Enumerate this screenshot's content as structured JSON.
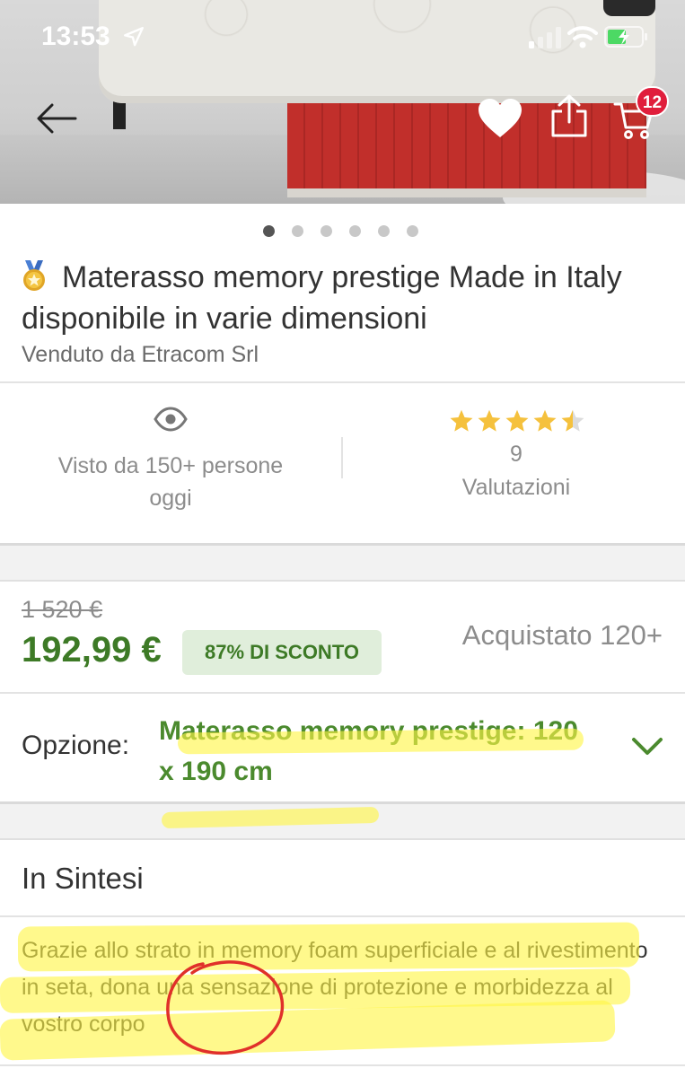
{
  "status_bar": {
    "time": "13:53"
  },
  "header": {
    "icons": [
      "back-arrow-icon",
      "heart-icon",
      "share-icon",
      "cart-icon"
    ],
    "cart_count": "12"
  },
  "carousel": {
    "total": 6,
    "active_index": 0
  },
  "product": {
    "title": "Materasso memory prestige Made in Italy disponibile in varie dimensioni",
    "seller": "Venduto da Etracom Srl"
  },
  "stats": {
    "views": "Visto da 150+ persone oggi",
    "rating": 4.5,
    "rating_count": "9",
    "rating_label": "Valutazioni"
  },
  "pricing": {
    "old_price": "1 520 €",
    "price": "192,99 €",
    "discount": "87% DI SCONTO",
    "bought": "Acquistato 120+"
  },
  "option": {
    "label": "Opzione:",
    "value": "Materasso memory prestige: 120 x 190 cm"
  },
  "summary": {
    "title": "In Sintesi",
    "text": "Grazie allo strato in memory foam superficiale e al rivestimento in seta, dona una sensazione di protezione e morbidezza al vostro corpo"
  },
  "colors": {
    "brand_green": "#3d7a26",
    "option_green": "#4b8a2e",
    "discount_bg": "#e0eedb",
    "star_gold": "#f5c13d",
    "badge_red": "#e01e3c",
    "highlight_yellow": "#fff546",
    "annotation_red": "#e0302a"
  }
}
